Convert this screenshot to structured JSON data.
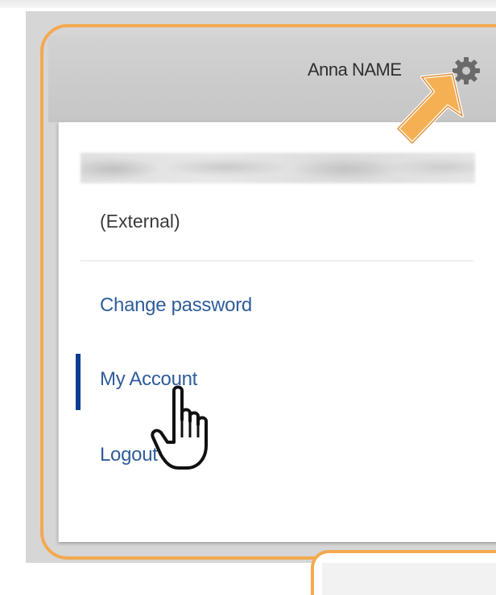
{
  "header": {
    "user_name": "Anna NAME",
    "settings_icon": "gear-icon"
  },
  "menu": {
    "account_type": "(External)",
    "items": [
      {
        "label": "Change password",
        "active": false
      },
      {
        "label": "My Account",
        "active": true
      },
      {
        "label": "Logout",
        "active": false
      }
    ]
  },
  "annotations": {
    "pointer_icon": "arrow-icon",
    "cursor_icon": "hand-pointer-icon"
  },
  "colors": {
    "highlight": "#f3a950",
    "link": "#2f5d9a",
    "active_indicator": "#0a3d8f",
    "header_bg": "#c9c9c9"
  }
}
